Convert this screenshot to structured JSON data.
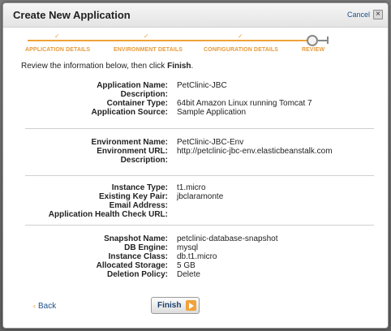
{
  "dialog": {
    "title": "Create New Application",
    "cancel_label": "Cancel",
    "close_glyph": "×"
  },
  "wizard": {
    "steps": [
      {
        "label": "APPLICATION DETAILS",
        "state": "complete"
      },
      {
        "label": "ENVIRONMENT DETAILS",
        "state": "complete"
      },
      {
        "label": "CONFIGURATION DETAILS",
        "state": "complete"
      },
      {
        "label": "REVIEW",
        "state": "current"
      }
    ],
    "tick_glyph": "✓"
  },
  "intro": {
    "text": "Review the information below, then click ",
    "emphasis": "Finish",
    "suffix": "."
  },
  "application": [
    {
      "label": "Application Name:",
      "value": "PetClinic-JBC"
    },
    {
      "label": "Description:",
      "value": ""
    },
    {
      "label": "Container Type:",
      "value": "64bit Amazon Linux running Tomcat 7"
    },
    {
      "label": "Application Source:",
      "value": "Sample Application"
    }
  ],
  "environment": [
    {
      "label": "Environment Name:",
      "value": "PetClinic-JBC-Env"
    },
    {
      "label": "Environment URL:",
      "value": "http://petclinic-jbc-env.elasticbeanstalk.com"
    },
    {
      "label": "Description:",
      "value": ""
    }
  ],
  "configuration": [
    {
      "label": "Instance Type:",
      "value": "t1.micro"
    },
    {
      "label": "Existing Key Pair:",
      "value": "jbclaramonte"
    },
    {
      "label": "Email Address:",
      "value": ""
    },
    {
      "label": "Application Health Check URL:",
      "value": ""
    }
  ],
  "database": [
    {
      "label": "Snapshot Name:",
      "value": "petclinic-database-snapshot"
    },
    {
      "label": "DB Engine:",
      "value": "mysql"
    },
    {
      "label": "Instance Class:",
      "value": "db.t1.micro"
    },
    {
      "label": "Allocated Storage:",
      "value": "5 GB"
    },
    {
      "label": "Deletion Policy:",
      "value": "Delete"
    }
  ],
  "footer": {
    "back_label": "Back",
    "back_glyph": "‹",
    "finish_label": "Finish"
  },
  "colors": {
    "accent_orange": "#f0a23a",
    "link_blue": "#1b4f8a"
  }
}
